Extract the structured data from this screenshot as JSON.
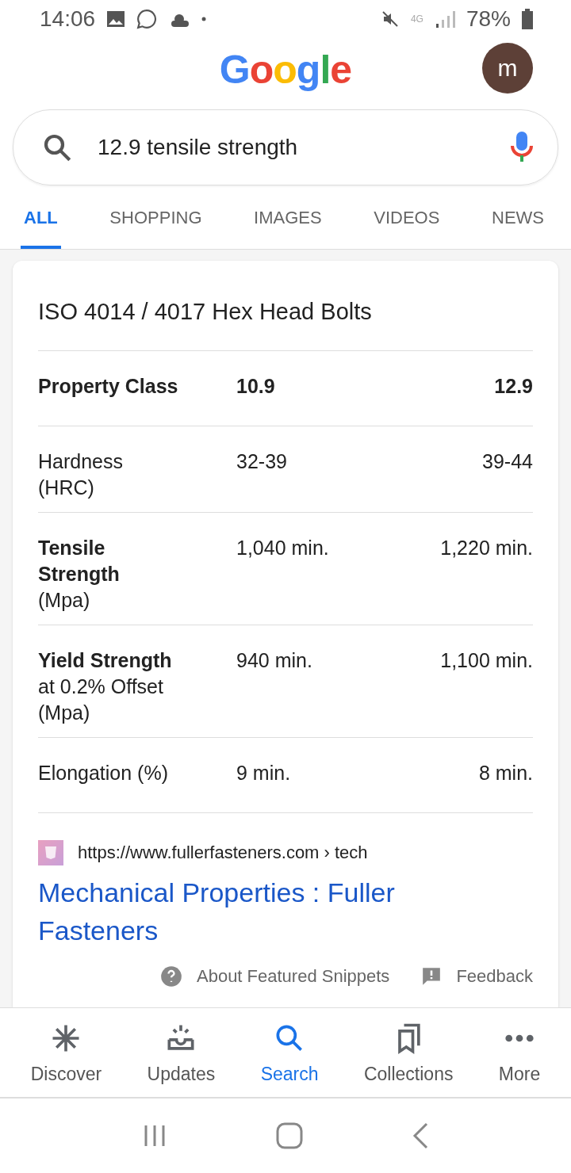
{
  "status_bar": {
    "time": "14:06",
    "network": "4G",
    "battery": "78%"
  },
  "header": {
    "logo": "Google",
    "avatar": "m"
  },
  "search": {
    "value": "12.9 tensile strength"
  },
  "tabs": [
    {
      "label": "ALL",
      "selected": true
    },
    {
      "label": "SHOPPING",
      "selected": false
    },
    {
      "label": "IMAGES",
      "selected": false
    },
    {
      "label": "VIDEOS",
      "selected": false
    },
    {
      "label": "NEWS",
      "selected": false
    }
  ],
  "snippet": {
    "title": "ISO 4014 / 4017 Hex Head Bolts",
    "rows": [
      {
        "kind": "header",
        "label": [
          "Property Class"
        ],
        "col_1": "10.9",
        "col_2": "12.9"
      },
      {
        "kind": "data",
        "label": [
          "Hardness",
          "(HRC)"
        ],
        "col_1": "32-39",
        "col_2": "39-44"
      },
      {
        "kind": "data",
        "label": [
          "**Tensile**",
          "**Strength**",
          "(Mpa)"
        ],
        "col_1": "1,040 min.",
        "col_2": "1,220 min."
      },
      {
        "kind": "data",
        "label": [
          "**Yield Strength**",
          "at 0.2% Offset",
          "(Mpa)"
        ],
        "col_1": "940 min.",
        "col_2": "1,100 min."
      },
      {
        "kind": "data",
        "label": [
          "Elongation (%)"
        ],
        "col_1": "9 min.",
        "col_2": "8 min."
      }
    ],
    "source_url": "https://www.fullerfasteners.com › tech",
    "link": "Mechanical Properties : Fuller Fasteners",
    "about": "About Featured Snippets",
    "feedback": "Feedback"
  },
  "bottom_nav": [
    {
      "kind": "discover",
      "label": "Discover",
      "selected": false
    },
    {
      "kind": "updates",
      "label": "Updates",
      "selected": false
    },
    {
      "kind": "search",
      "label": "Search",
      "selected": true
    },
    {
      "kind": "collections",
      "label": "Collections",
      "selected": false
    },
    {
      "kind": "more",
      "label": "More",
      "selected": false
    }
  ]
}
